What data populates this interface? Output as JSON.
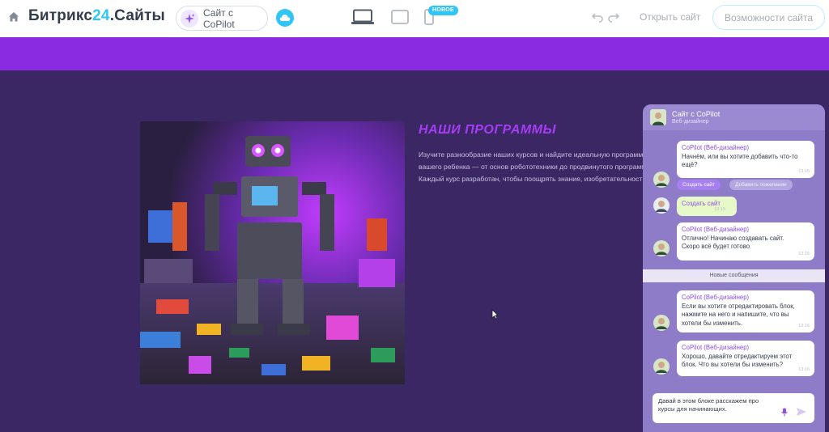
{
  "topbar": {
    "logo_part1": "Битрикс",
    "logo_part2": "24",
    "logo_part3": ".Сайты",
    "copilot_button": "Сайт с CoPilot",
    "new_badge": "НОВОЕ",
    "open_site": "Открыть сайт",
    "features_button": "Возможности сайта"
  },
  "section": {
    "title": "НАШИ ПРОГРАММЫ",
    "text_line1": "Изучите разнообразие наших курсов и найдите идеальную программ",
    "text_line2": "вашего ребенка — от основ робототехники до продвинутого программ",
    "text_line3": "Каждый курс разработан, чтобы поощрять знание, изобретательност"
  },
  "chat": {
    "title": "Сайт с CoPilot",
    "subtitle": "Веб-дизайнер",
    "messages": [
      {
        "author": "CoPilot (Веб-дизайнер)",
        "text1": "Начнём, или вы хотите добавить что-то",
        "text2": "ещё?",
        "time": "13:15"
      },
      {
        "text1": "Создать сайт",
        "time": "13:15"
      },
      {
        "author": "CoPilot (Веб-дизайнер)",
        "text1": "Отлично! Начинаю создавать сайт.",
        "text2": "Скоро всё будет готово",
        "time": "13:15"
      },
      {
        "author": "CoPilot (Веб-дизайнер)",
        "text1": "Если вы хотите отредактировать блок,",
        "text2": "нажмите на него и напишите, что вы",
        "text3": "хотели бы изменить.",
        "time": "13:16"
      },
      {
        "author": "CoPilot (Веб-дизайнер)",
        "text1": "Хорошо, давайте отредактируем этот",
        "text2": "блок. Что вы хотели бы изменить?",
        "time": "13:16"
      }
    ],
    "chip_create": "Создать сайт",
    "chip_add": "Добавить пожелание",
    "new_messages": "Новые сообщения",
    "input_line1": "Давай в этом блоке расскажем про",
    "input_line2": "курсы для начинающих."
  },
  "colors": {
    "accent": "#2fc6f6",
    "strip": "#8a2be2",
    "section_bg": "#3a2763",
    "title": "#a63df5"
  }
}
